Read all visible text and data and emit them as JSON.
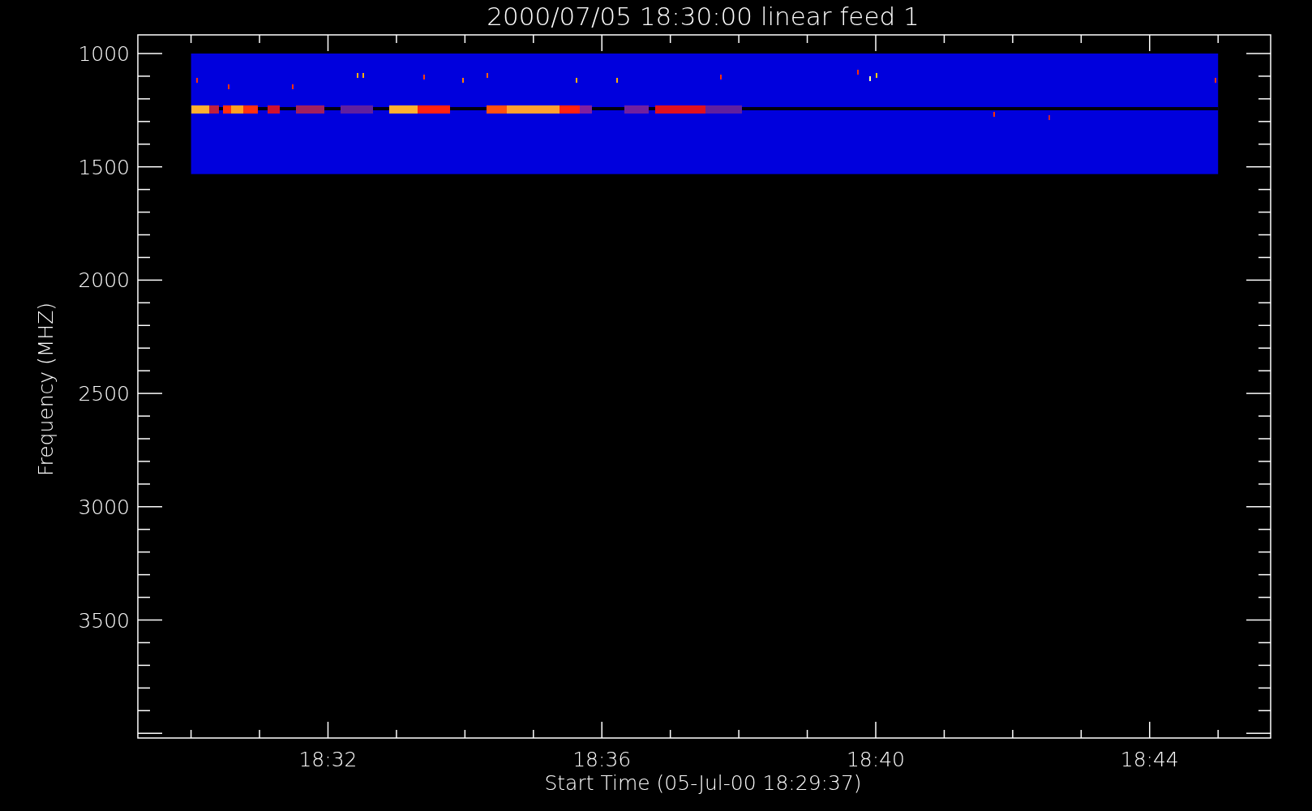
{
  "plot": {
    "title": "2000/07/05 18:30:00 linear feed 1",
    "ylabel": "Frequency (MHZ)",
    "xlabel": "Start Time (05-Jul-00 18:29:37)",
    "y_tick_labels": [
      "1000",
      "1500",
      "2000",
      "2500",
      "3000",
      "3500"
    ],
    "x_tick_labels": [
      "18:32",
      "18:36",
      "18:40",
      "18:44"
    ]
  }
}
